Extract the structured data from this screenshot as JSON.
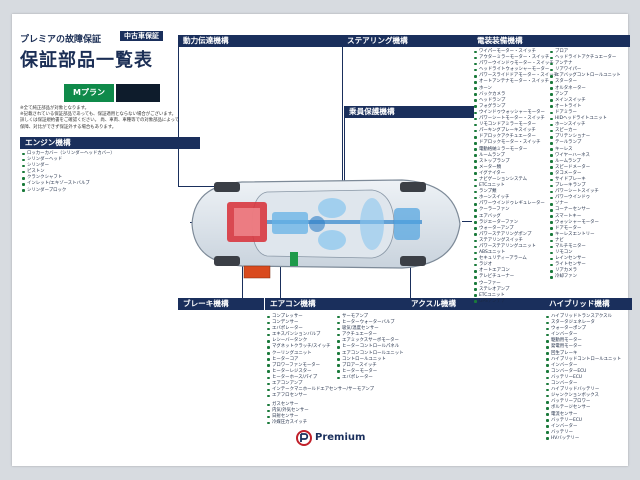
{
  "header": {
    "subtitle": "プレミアの故障保証",
    "badge": "中古車保証",
    "title": "保証部品一覧表"
  },
  "plan": {
    "label": "Mプラン",
    "notes": [
      "※全て純正部品が対象となります。",
      "※記載されている保証部品であっても、保証適用とならない場合がございます。",
      "詳しくは保証規約書をご確認ください。 尚、車両、車種等での対象部品によって",
      "保障、対比ができず保証外する場合もあります。"
    ]
  },
  "groups": {
    "engine": {
      "title": "エンジン機構",
      "items": [
        "ロッカーカバー（シリンダーヘッドカバー）",
        "シリンダーヘッド",
        "シリンダー",
        "ピストン",
        "クランクシャフト",
        "インレット/エキゾーストバルブ",
        "シリンダーブロック"
      ]
    },
    "power": {
      "title": "動力伝達機構"
    },
    "steering": {
      "title": "ステアリング機構"
    },
    "seat": {
      "title": "乗員保護機構"
    },
    "brake": {
      "title": "ブレーキ機構"
    },
    "aircon": {
      "title": "エアコン機構",
      "col1": [
        "コンプレッサー",
        "コンデンサー",
        "エバポレーター",
        "エキスパンションバルブ",
        "レシーバータンク",
        "マグネットクラッチ/スイッチ",
        "クーリングユニット",
        "ヒーターコア",
        "ブロワーファンモーター",
        "ヒーターレジスター",
        "ヒーターホース/パイプ",
        "エアコンアンプ",
        "インテークマニホールドエアセンサー/サーモアンプ",
        "エアフロセンサー"
      ],
      "col1b": [
        "ガスセンサー",
        "内気/外気センサー",
        "日射センサー",
        "冷媒圧力スイッチ"
      ],
      "col2": [
        "サーモアンプ",
        "ヒーターウォーターバルブ",
        "吸気/温度センサー",
        "アクチュエーター",
        "エアミックスサーボモーター",
        "ヒーターコントロールパネル",
        "エアコンコントロールユニット",
        "コントロールユニット",
        "ブロアースイッチ",
        "ヒーターモーター",
        "エバポレーター"
      ]
    },
    "axle": {
      "title": "アクスル機構"
    },
    "electrical": {
      "title": "電装装備機構",
      "col1": [
        "ワイパーモーター・スイッチ",
        "アウターミラーモーター・スイッチ",
        "パワーウインドゥモーター・スイッチ",
        "ヘッドライトウォッシャーモーター",
        "パワースライドドアモーター・スイッチ",
        "オートアンテナモーター・スイッチ",
        "ホーン",
        "バックカメラ",
        "ヘッドランプ",
        "フォグランプ",
        "ウインドゥウォッシャーモーター",
        "パワーシートモーター・スイッチ",
        "リモコンドアミラーモーター",
        "パーキングブレーキスイッチ",
        "ドアロックアクチュエーター",
        "ドアロックモーター・スイッチ",
        "電動格納ミラーモーター",
        "ルームランプ",
        "ストップランプ",
        "メーター類",
        "イグナイター",
        "ナビゲーションシステム",
        "ETCユニット",
        "ランプ類",
        "ホーンスイッチ",
        "パワーウインドゥレギュレーター",
        "クーラーファン",
        "エアバッグ",
        "ラジエーターファン",
        "ウォーターアンプ",
        "パワーステアリングポンプ",
        "ステアリングスイッチ",
        "パワーステアリングユニット",
        "ABSユニット",
        "セキュリティーアラーム",
        "ラジオ",
        "オートエアコン",
        "テレビチューナー",
        "ウーファー",
        "ステレオアンプ",
        "ETCユニット",
        "GPSアンテナ",
        "ラジオ/TVアンテナ"
      ],
      "col2": [
        "ブロア",
        "ヘッドライトアクチュエーター",
        "アンテナ",
        "リアワイパー",
        "エアバッグコントロールユニット",
        "スターター",
        "オルタネーター",
        "アンプ",
        "メインスイッチ",
        "オートライト",
        "ドアミラー",
        "HIDヘッドライトユニット",
        "ホーンスイッチ",
        "スピーカー",
        "プリテンショナー",
        "テールランプ",
        "キーレス",
        "ワイヤーハーネス",
        "ルームランプ",
        "スピードメーター",
        "タコメーター",
        "サイドブレーキ",
        "ブレーキランプ",
        "パワーシートスイッチ",
        "パワーウインドゥ",
        "ソナー",
        "コーナーセンサー",
        "スマートキー",
        "ウォッシャーモーター",
        "ドアモーター",
        "キーレスエントリー",
        "ナビ",
        "マルチモニター",
        "リモコン",
        "レインセンサー",
        "ライトセンサー",
        "リアカメラ",
        "冷却ファン"
      ]
    },
    "hybrid": {
      "title": "ハイブリッド機構",
      "items": [
        "ハイブリッドトランスアクスル",
        "スタータジェネレータ",
        "ウォーターポンプ",
        "インバーター",
        "駆動用モーター",
        "発電用モーター",
        "回生ブレーキ",
        "ハイブリッドコントロールユニット",
        "インバーター",
        "コンバーターECU",
        "バッテリーECU",
        "コンバーター",
        "ハイブリッドバッテリー",
        "ジャンクションボックス",
        "バッテリーブロワー",
        "ボルテージセンサー",
        "電流センサー",
        "バッテリーECU",
        "インバーター",
        "バッテリー",
        "HVバッテリー"
      ]
    }
  },
  "footer": {
    "brand": "Premium"
  }
}
